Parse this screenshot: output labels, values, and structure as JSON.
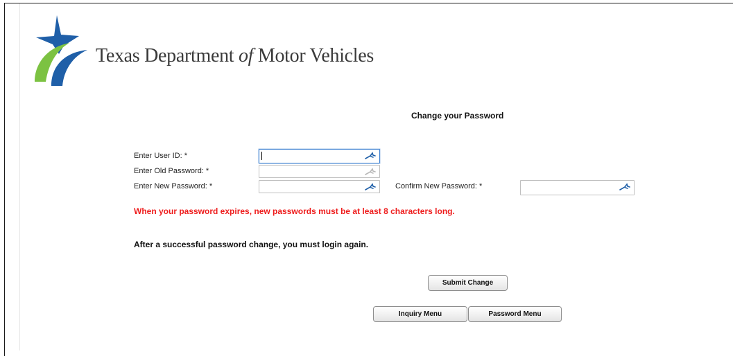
{
  "header": {
    "org_name_before": "Texas Department ",
    "org_name_of": "of",
    "org_name_after": " Motor Vehicles",
    "logo_icon": "txdmv-star-swoosh-logo"
  },
  "page_title": "Change your Password",
  "form": {
    "user_id_label": "Enter User ID: *",
    "user_id_value": "",
    "old_password_label": "Enter Old Password: *",
    "old_password_value": "",
    "new_password_label": "Enter New Password: *",
    "new_password_value": "",
    "confirm_password_label": "Confirm New Password: *",
    "confirm_password_value": "",
    "field_icon": "key-icon"
  },
  "messages": {
    "warning": "When your password expires, new passwords must be at least 8 characters long.",
    "note": "After a successful password change, you must login again."
  },
  "buttons": {
    "submit": "Submit Change",
    "inquiry_menu": "Inquiry Menu",
    "password_menu": "Password Menu"
  },
  "colors": {
    "warning": "#ee1c1c",
    "logo_blue": "#1f5fa8",
    "logo_green": "#7cc242",
    "focus_border": "#3c7fd1"
  }
}
